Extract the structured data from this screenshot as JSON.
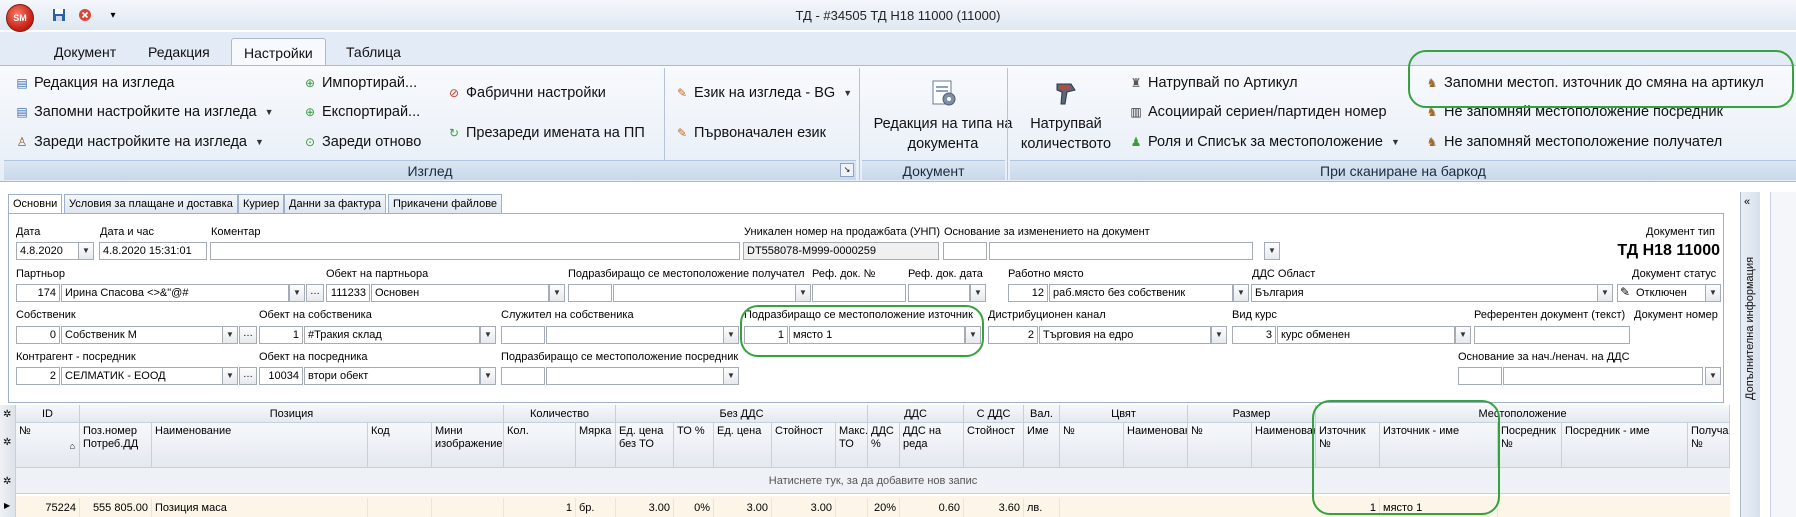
{
  "window": {
    "title": "ТД - #34505 ТД Н18 11000 (11000)",
    "orb": "SM"
  },
  "ribbon_tabs": [
    "Документ",
    "Редакция",
    "Настройки",
    "Таблица"
  ],
  "ribbon": {
    "view": {
      "caption": "Изглед",
      "edit_view": "Редакция на изгледа",
      "save_view_settings": "Запомни настройките на изгледа",
      "load_view_settings": "Зареди настройките на изгледа",
      "import": "Импортирай...",
      "export": "Експортирай...",
      "reload": "Зареди отново",
      "factory_settings": "Фабрични настройки",
      "reload_names": "Презареди имената на ПП",
      "view_language": "Език на изгледа - BG",
      "original_language": "Първоначален език"
    },
    "document": {
      "caption": "Документ",
      "edit_doc_type": "Редакция на типа на документа"
    },
    "barcode": {
      "caption": "При сканиране на баркод",
      "stack_quantity": "Натрупвай количеството",
      "stack_by_article": "Натрупвай по Артикул",
      "assoc_serial": "Асоциирай сериен/партиден номер",
      "role_location_list": "Роля и Списък за местоположение",
      "remember_source": "Запомни местоп. източник до смяна на артикул",
      "no_remember_intermediary": "Не запомняй местоположение посредник",
      "no_remember_recipient": "Не запомняй местоположение получател"
    }
  },
  "doc_tabs": [
    "Основни",
    "Условия за плащане и доставка",
    "Куриер",
    "Данни за фактура",
    "Прикачени файлове"
  ],
  "form": {
    "date_label": "Дата",
    "date_value": "4.8.2020",
    "datetime_label": "Дата и час",
    "datetime_value": "4.8.2020 15:31:01",
    "comment_label": "Коментар",
    "comment_value": "",
    "unp_label": "Уникален номер на продажбата (УНП)",
    "unp_value": "DT558078-M999-0000259",
    "change_reason_label": "Основание за изменението на документ",
    "doc_type_label": "Документ тип",
    "doc_type_value": "ТД Н18 11000",
    "partner_label": "Партньор",
    "partner_id": "174",
    "partner_name": "Ирина Спасова <>&\"@#",
    "partner_object_label": "Обект на партньора",
    "partner_object_id": "111233",
    "partner_object_name": "Основен",
    "dest_location_label": "Подразбиращо се местоположение получател",
    "ref_doc_no_label": "Реф. док. №",
    "ref_doc_date_label": "Реф. док. дата",
    "workplace_label": "Работно място",
    "workplace_id": "12",
    "workplace_name": "раб.място без собственик",
    "vat_area_label": "ДДС Област",
    "vat_area_value": "България",
    "doc_status_label": "Документ статус",
    "doc_status_value": "Отключен",
    "owner_label": "Собственик",
    "owner_id": "0",
    "owner_name": "Собственик М",
    "owner_object_label": "Обект на собственика",
    "owner_object_id": "1",
    "owner_object_name": "#Тракия склад",
    "owner_employee_label": "Служител на собственика",
    "source_location_label": "Подразбиращо се местоположение източник",
    "source_location_id": "1",
    "source_location_name": "място 1",
    "dist_channel_label": "Дистрибуционен канал",
    "dist_channel_id": "2",
    "dist_channel_name": "Търговия на едро",
    "rate_type_label": "Вид курс",
    "rate_type_id": "3",
    "rate_type_name": "курс обменен",
    "ref_doc_text_label": "Референтен документ (текст)",
    "doc_number_label": "Документ номер",
    "intermediary_label": "Контрагент - посредник",
    "intermediary_id": "2",
    "intermediary_name": "СЕЛМАТИК - ЕООД",
    "intermediary_object_label": "Обект на посредника",
    "intermediary_object_id": "10034",
    "intermediary_object_name": "втори обект",
    "intermediary_location_label": "Подразбиращо се местоположение посредник",
    "vat_reason_label": "Основание за нач./ненач. на ДДС"
  },
  "side_panel": {
    "label": "Допълнителна информация"
  },
  "grid": {
    "group_headers": [
      "ID",
      "Позиция",
      "Количество",
      "Без ДДС",
      "ДДС",
      "С ДДС",
      "Вал.",
      "Цвят",
      "Размер",
      "Местоположение"
    ],
    "columns": [
      "№",
      "Поз.номер Потреб.ДД",
      "Наименование",
      "Код",
      "Мини изображение",
      "Кол.",
      "Мярка",
      "Ед. цена без ТО",
      "ТО %",
      "Ед. цена",
      "Стойност",
      "Макс. ТО",
      "ДДС %",
      "ДДС на реда",
      "Стойност",
      "Име",
      "№",
      "Наименование",
      "№",
      "Наименование",
      "Източник №",
      "Източник - име",
      "Посредник №",
      "Посредник - име",
      "Получа №"
    ],
    "new_row_hint": "Натиснете тук, за да добавите нов запис",
    "row": {
      "id": "75224",
      "pos": "555 805.00",
      "name": "Позиция маса",
      "qty": "1",
      "unit": "бр.",
      "unit_price_no_to": "3.00",
      "to_pct": "0%",
      "unit_price": "3.00",
      "value": "3.00",
      "vat_pct": "20%",
      "vat_row": "0.60",
      "value_vat": "3.60",
      "currency": "лв.",
      "source_no": "1",
      "source_name": "място 1"
    }
  }
}
